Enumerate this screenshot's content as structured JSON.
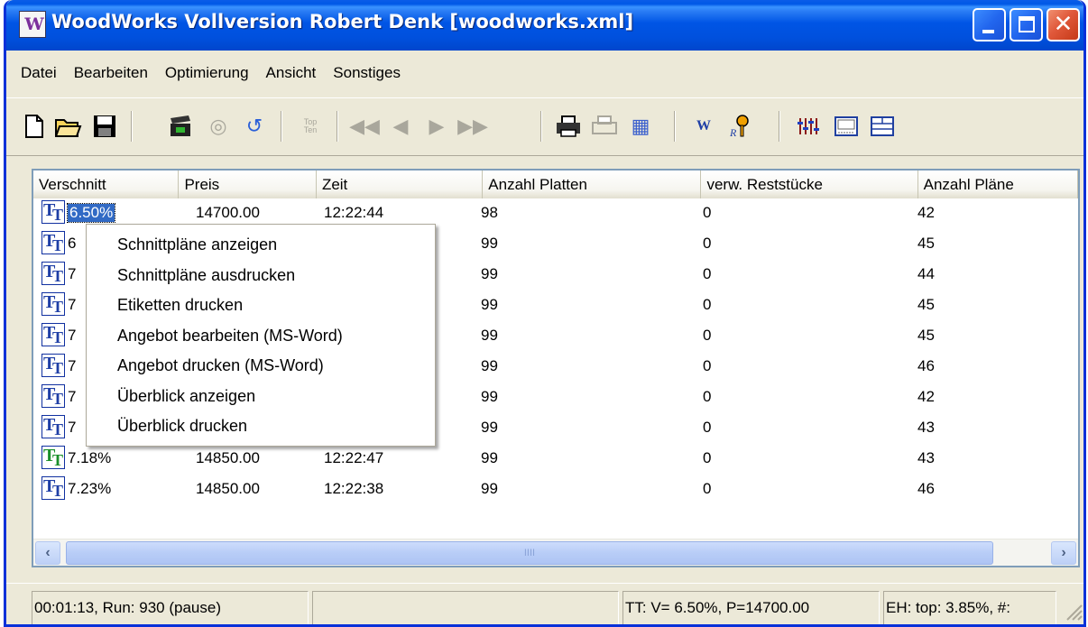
{
  "window": {
    "title": "WoodWorks Vollversion Robert Denk [woodworks.xml]",
    "icon_label": "W",
    "minimize": "",
    "maximize": "",
    "close": "✕"
  },
  "menu": [
    "Datei",
    "Bearbeiten",
    "Optimierung",
    "Ansicht",
    "Sonstiges"
  ],
  "toolbar": {
    "buttons": [
      {
        "name": "new-icon",
        "glyph": "🗋"
      },
      {
        "name": "open-icon",
        "glyph": "📂"
      },
      {
        "name": "save-icon",
        "glyph": "💾"
      },
      {
        "name": "run-icon",
        "glyph": "🎬"
      },
      {
        "name": "stop-icon",
        "glyph": "◎"
      },
      {
        "name": "reset-icon",
        "glyph": "↺"
      },
      {
        "name": "top-ten-icon",
        "glyph": "TopTen"
      },
      {
        "name": "first-icon",
        "glyph": "⏮"
      },
      {
        "name": "prev-icon",
        "glyph": "◀"
      },
      {
        "name": "next-icon",
        "glyph": "▶"
      },
      {
        "name": "last-icon",
        "glyph": "⏭"
      },
      {
        "name": "print-icon",
        "glyph": "🖶"
      },
      {
        "name": "print-preview-icon",
        "glyph": "🖶"
      },
      {
        "name": "grid-icon",
        "glyph": "▦"
      },
      {
        "name": "woodworks-icon",
        "glyph": "W"
      },
      {
        "name": "key-icon",
        "glyph": "🔑"
      },
      {
        "name": "sliders-icon",
        "glyph": "☷"
      },
      {
        "name": "window-icon",
        "glyph": "▭"
      },
      {
        "name": "layout-icon",
        "glyph": "▤"
      }
    ]
  },
  "table": {
    "columns": [
      "Verschnitt",
      "Preis",
      "Zeit",
      "Anzahl Platten",
      "verw. Reststücke",
      "Anzahl Pläne"
    ],
    "rows": [
      {
        "verschnitt": "6.50%",
        "preis": "14700.00",
        "zeit": "12:22:44",
        "platten": "98",
        "rest": "0",
        "plaene": "42",
        "selected": true
      },
      {
        "verschnitt": "6",
        "preis": "",
        "zeit": "",
        "platten": "99",
        "rest": "0",
        "plaene": "45"
      },
      {
        "verschnitt": "7",
        "preis": "",
        "zeit": "",
        "platten": "99",
        "rest": "0",
        "plaene": "44"
      },
      {
        "verschnitt": "7",
        "preis": "",
        "zeit": "",
        "platten": "99",
        "rest": "0",
        "plaene": "45"
      },
      {
        "verschnitt": "7",
        "preis": "",
        "zeit": "",
        "platten": "99",
        "rest": "0",
        "plaene": "45"
      },
      {
        "verschnitt": "7",
        "preis": "",
        "zeit": "",
        "platten": "99",
        "rest": "0",
        "plaene": "46"
      },
      {
        "verschnitt": "7",
        "preis": "",
        "zeit": "",
        "platten": "99",
        "rest": "0",
        "plaene": "42"
      },
      {
        "verschnitt": "7",
        "preis": "",
        "zeit": "",
        "platten": "99",
        "rest": "0",
        "plaene": "43"
      },
      {
        "verschnitt": "7.18%",
        "preis": "14850.00",
        "zeit": "12:22:47",
        "platten": "99",
        "rest": "0",
        "plaene": "43",
        "green": true
      },
      {
        "verschnitt": "7.23%",
        "preis": "14850.00",
        "zeit": "12:22:38",
        "platten": "99",
        "rest": "0",
        "plaene": "46"
      }
    ]
  },
  "scrollbar": {
    "left": "‹",
    "right": "›",
    "grip": "IIII"
  },
  "context_menu": [
    "Schnittpläne anzeigen",
    "Schnittpläne ausdrucken",
    "Etiketten drucken",
    "Angebot bearbeiten (MS-Word)",
    "Angebot drucken (MS-Word)",
    "Überblick anzeigen",
    "Überblick drucken"
  ],
  "status": {
    "run": "00:01:13, Run: 930 (pause)",
    "empty": "",
    "tt": "TT: V= 6.50%, P=14700.00",
    "eh": "EH: top: 3.85%,  #:"
  },
  "colors": {
    "titlebar": "#0055e5",
    "selection": "#316ac5",
    "face": "#ece9d8"
  }
}
